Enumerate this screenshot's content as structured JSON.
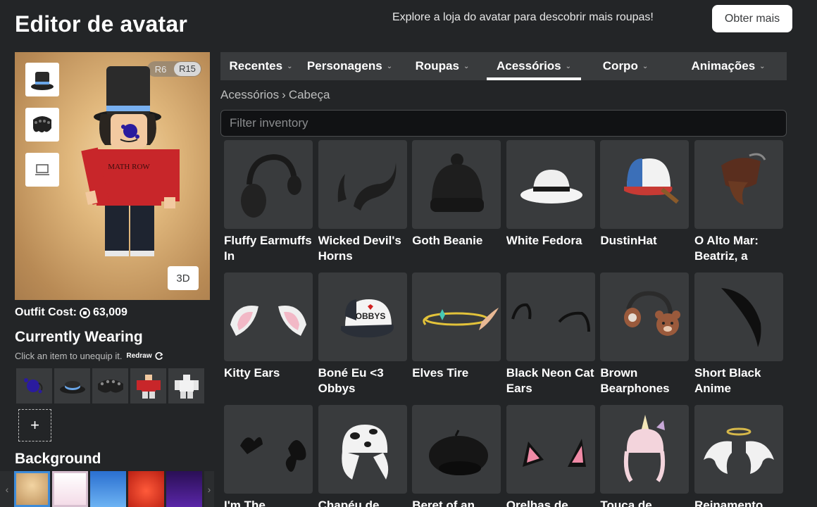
{
  "header": {
    "title": "Editor de avatar",
    "promo_text": "Explore a loja do avatar para descobrir mais roupas!",
    "obtain_more_label": "Obter mais"
  },
  "preview": {
    "rig_options": [
      "R6",
      "R15"
    ],
    "rig_selected": "R15",
    "view_3d_label": "3D",
    "thumbnails": [
      "top-hat-icon",
      "chain-hair-icon",
      "shirt-icon"
    ]
  },
  "outfit": {
    "cost_label": "Outfit Cost:",
    "cost_value": "63,009"
  },
  "currently_wearing": {
    "title": "Currently Wearing",
    "help_text": "Click an item to unequip it.",
    "redraw_label": "Redraw",
    "items": [
      "face-splat",
      "top-hat",
      "chain-hair",
      "red-shirt",
      "white-body"
    ],
    "add_label": "+"
  },
  "background": {
    "title": "Background",
    "swatches": [
      "#d9b27a",
      "#f6e2ec",
      "#4f9ae8",
      "#e23a2a",
      "#4b1d8a"
    ]
  },
  "tabs": [
    {
      "label": "Recentes",
      "active": false
    },
    {
      "label": "Personagens",
      "active": false
    },
    {
      "label": "Roupas",
      "active": false
    },
    {
      "label": "Acessórios",
      "active": true
    },
    {
      "label": "Corpo",
      "active": false
    },
    {
      "label": "Animações",
      "active": false
    }
  ],
  "breadcrumb": {
    "parent": "Acessórios",
    "separator": "›",
    "current": "Cabeça"
  },
  "search": {
    "placeholder": "Filter inventory",
    "value": ""
  },
  "items": [
    {
      "name": "Fluffy Earmuffs In",
      "icon": "earmuffs"
    },
    {
      "name": "Wicked Devil's Horns",
      "icon": "horns"
    },
    {
      "name": "Goth Beanie",
      "icon": "beanie"
    },
    {
      "name": "White Fedora",
      "icon": "fedora"
    },
    {
      "name": "DustinHat",
      "icon": "cap"
    },
    {
      "name": "O Alto Mar: Beatriz, a",
      "icon": "pirate-hat"
    },
    {
      "name": "Kitty Ears",
      "icon": "kitty-ears"
    },
    {
      "name": "Boné Eu <3 Obbys",
      "icon": "obby-cap"
    },
    {
      "name": "Elves Tire",
      "icon": "elf-tiara"
    },
    {
      "name": "Black Neon Cat Ears",
      "icon": "cat-ears-black"
    },
    {
      "name": "Brown Bearphones",
      "icon": "bearphones"
    },
    {
      "name": "Short Black Anime",
      "icon": "anime-hair"
    },
    {
      "name": "I'm The",
      "icon": "black-bows"
    },
    {
      "name": "Chapéu de",
      "icon": "cow-hat"
    },
    {
      "name": "Beret of an",
      "icon": "beret"
    },
    {
      "name": "Orelhas de",
      "icon": "pink-cat-ears"
    },
    {
      "name": "Touca de",
      "icon": "unicorn-hat"
    },
    {
      "name": "Reinamento",
      "icon": "angel-wings"
    }
  ]
}
